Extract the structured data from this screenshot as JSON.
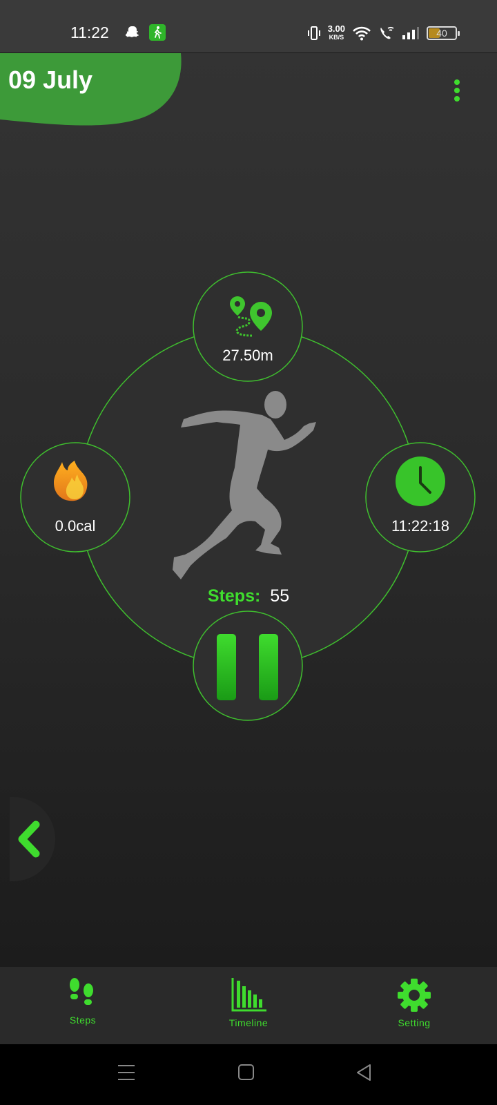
{
  "status_bar": {
    "time": "11:22",
    "net_speed": "3.00",
    "net_unit": "KB/S",
    "battery": "40"
  },
  "header": {
    "date": "09 July"
  },
  "stats": {
    "distance": "27.50m",
    "calories": "0.0cal",
    "timer": "11:22:18"
  },
  "steps": {
    "label": "Steps:",
    "value": "55"
  },
  "bottom_nav": {
    "items": [
      {
        "label": "Steps",
        "icon": "footsteps-icon"
      },
      {
        "label": "Timeline",
        "icon": "bar-chart-icon"
      },
      {
        "label": "Setting",
        "icon": "gear-icon"
      }
    ]
  },
  "colors": {
    "accent": "#3fdc2e",
    "background": "#2d2d2d",
    "date_blob": "#3d9a39"
  }
}
